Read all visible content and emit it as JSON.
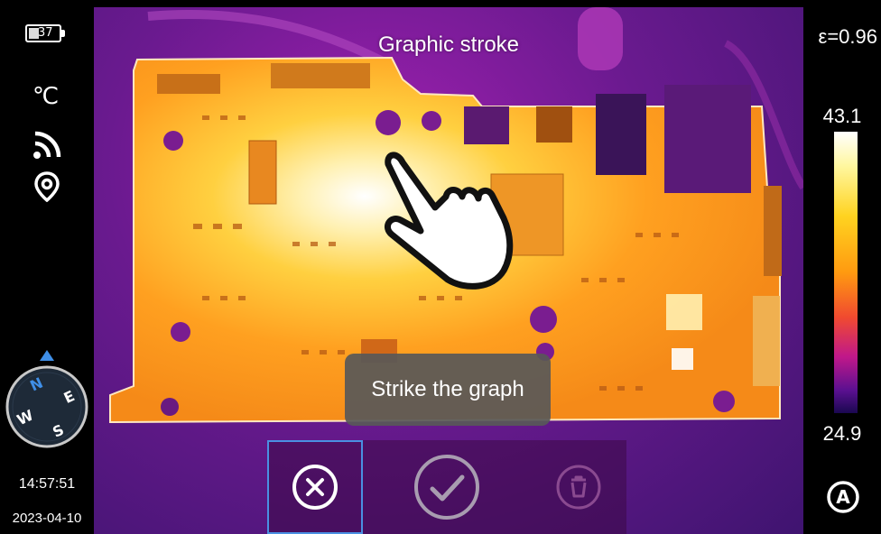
{
  "status": {
    "battery_level": "37",
    "temperature_unit": "℃",
    "compass": {
      "north": "N",
      "east": "E",
      "south": "S",
      "west": "W"
    },
    "time": "14:57:51",
    "date": "2023-04-10"
  },
  "viewer": {
    "title": "Graphic stroke",
    "toast": "Strike the graph"
  },
  "actions": {
    "cancel": "cancel",
    "confirm": "confirm",
    "delete": "delete"
  },
  "palette": {
    "emissivity": "ε=0.96",
    "max_temp": "43.1",
    "min_temp": "24.9",
    "mode_icon": "A"
  },
  "colors": {
    "accent_selected": "#4a90e2",
    "toast_bg": "#585858",
    "background": "#000000"
  }
}
